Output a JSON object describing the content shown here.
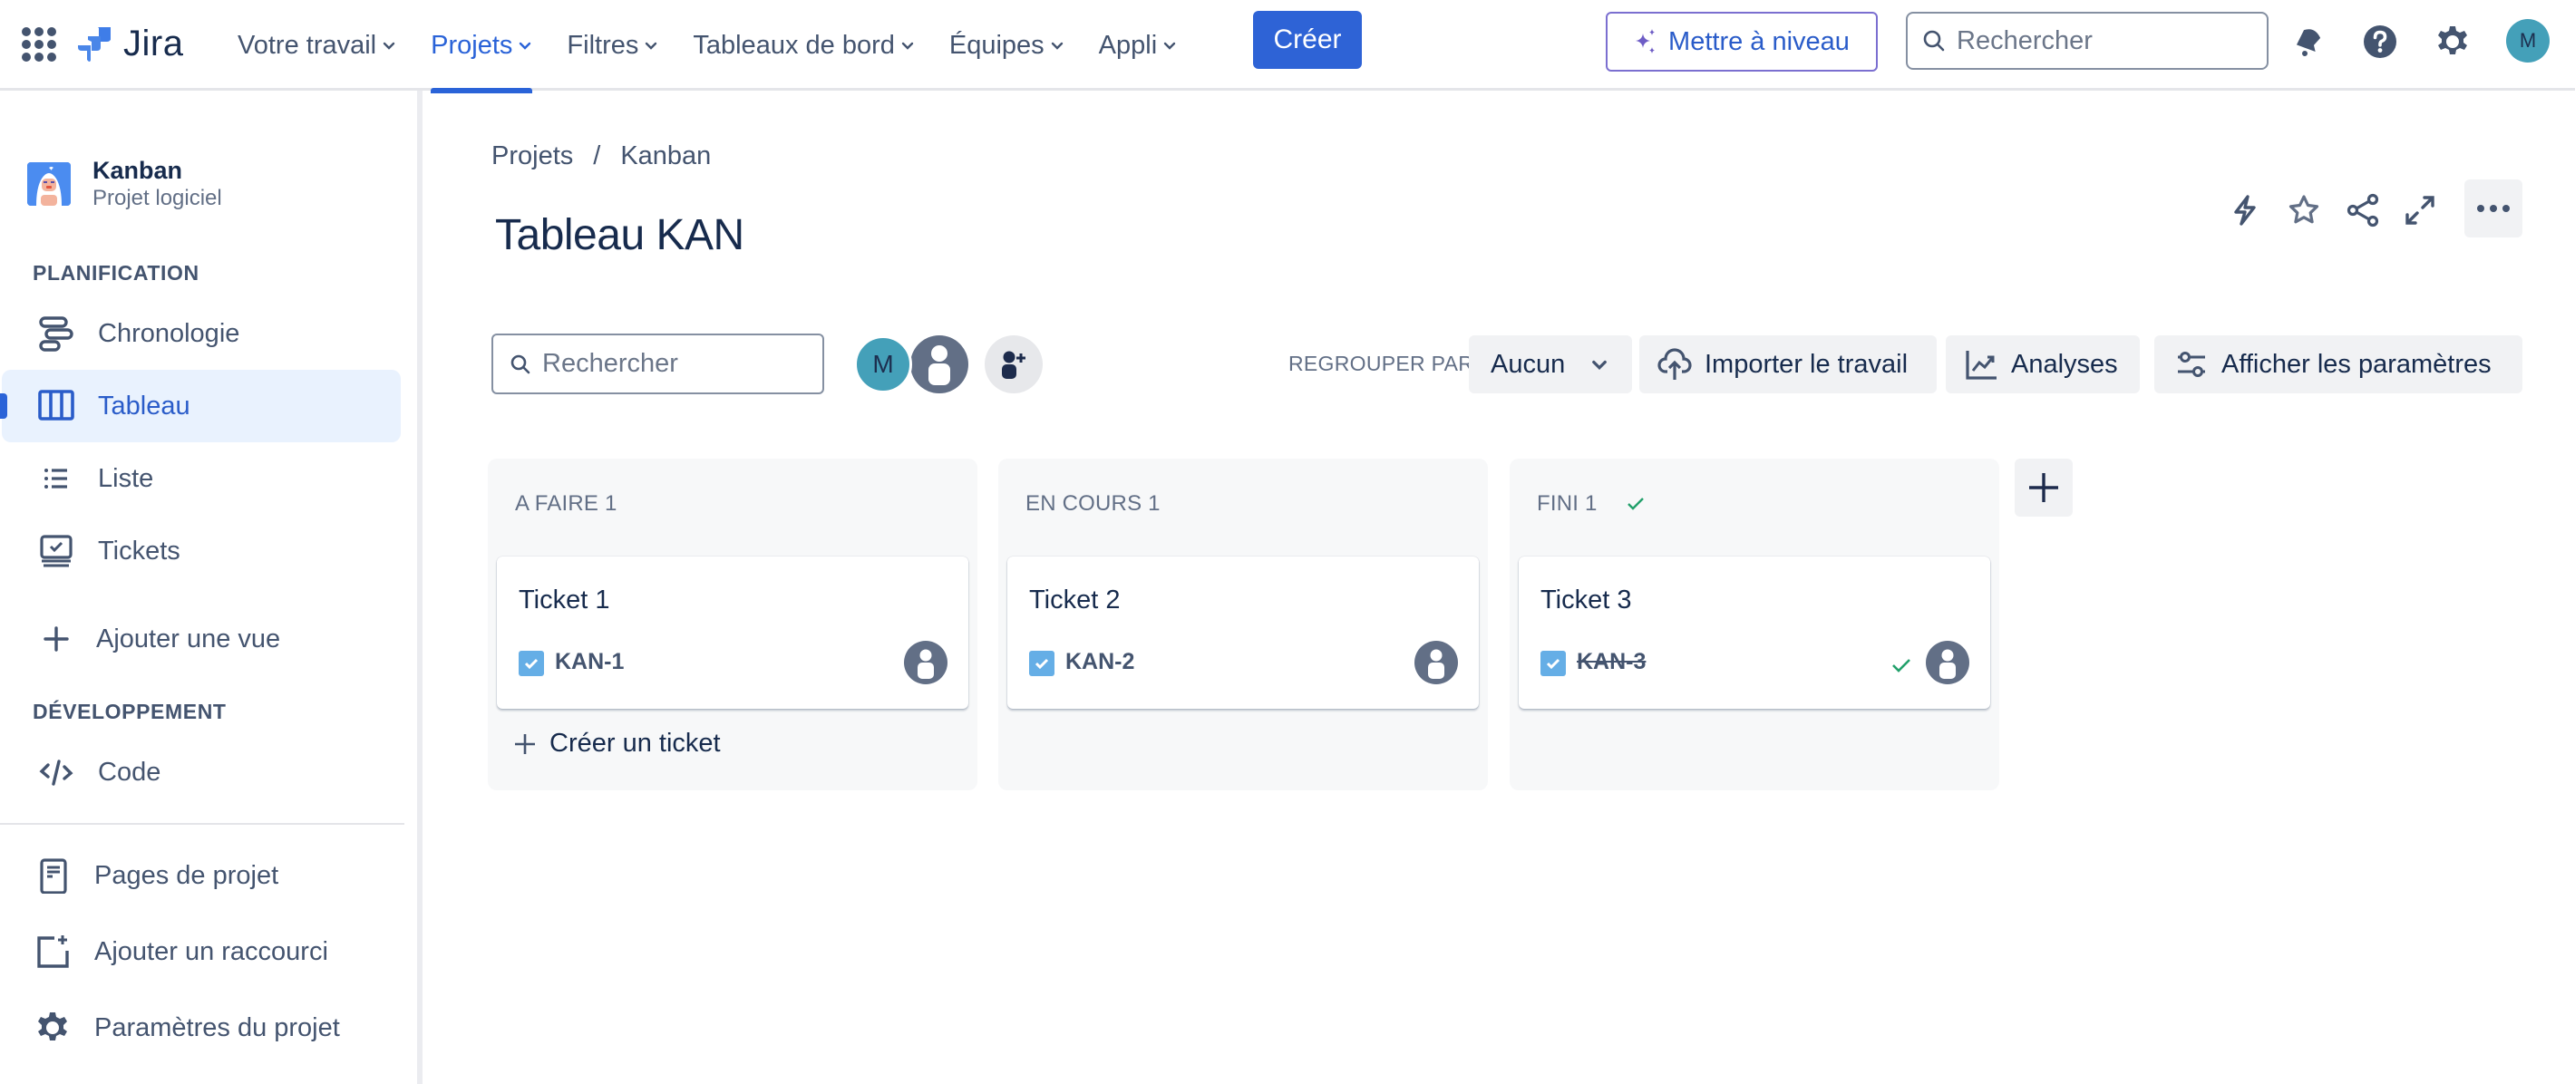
{
  "topbar": {
    "app_name": "Jira",
    "nav": [
      {
        "label": "Votre travail",
        "active": false
      },
      {
        "label": "Projets",
        "active": true
      },
      {
        "label": "Filtres",
        "active": false
      },
      {
        "label": "Tableaux de bord",
        "active": false
      },
      {
        "label": "Équipes",
        "active": false
      },
      {
        "label": "Appli",
        "active": false
      }
    ],
    "create_label": "Créer",
    "upgrade_label": "Mettre à niveau",
    "search_placeholder": "Rechercher",
    "icons": [
      "notifications-icon",
      "help-icon",
      "settings-icon"
    ],
    "user_initial": "M"
  },
  "sidebar": {
    "project": {
      "name": "Kanban",
      "type": "Projet logiciel"
    },
    "sections": [
      {
        "title": "PLANIFICATION"
      },
      {
        "title": "DÉVELOPPEMENT"
      }
    ],
    "items": [
      {
        "label": "Chronologie",
        "icon": "timeline-icon",
        "active": false
      },
      {
        "label": "Tableau",
        "icon": "board-icon",
        "active": true
      },
      {
        "label": "Liste",
        "icon": "list-icon",
        "active": false
      },
      {
        "label": "Tickets",
        "icon": "tickets-icon",
        "active": false
      },
      {
        "label": "Ajouter une vue",
        "icon": "plus-icon",
        "active": false
      },
      {
        "label": "Code",
        "icon": "code-icon",
        "active": false
      },
      {
        "label": "Pages de projet",
        "icon": "page-icon",
        "active": false
      },
      {
        "label": "Ajouter un raccourci",
        "icon": "add-shortcut-icon",
        "active": false
      },
      {
        "label": "Paramètres du projet",
        "icon": "settings-icon",
        "active": false
      }
    ]
  },
  "main": {
    "breadcrumb": [
      "Projets",
      "Kanban"
    ],
    "breadcrumb_separator": "/",
    "title": "Tableau KAN",
    "header_actions": [
      "automation-icon",
      "star-icon",
      "share-icon",
      "fullscreen-icon",
      "more-icon"
    ],
    "toolbar": {
      "search_placeholder": "Rechercher",
      "avatar_initial": "M",
      "group_by_label": "REGROUPER PAR",
      "group_by_value": "Aucun",
      "import_label": "Importer le travail",
      "analytics_label": "Analyses",
      "view_settings_label": "Afficher les paramètres"
    },
    "columns": [
      {
        "title": "A FAIRE 1",
        "done": false,
        "cards": [
          {
            "title": "Ticket 1",
            "key": "KAN-1",
            "done": false
          }
        ],
        "create_label": "Créer un ticket"
      },
      {
        "title": "EN COURS 1",
        "done": false,
        "cards": [
          {
            "title": "Ticket 2",
            "key": "KAN-2",
            "done": false
          }
        ]
      },
      {
        "title": "FINI 1",
        "done": true,
        "cards": [
          {
            "title": "Ticket 3",
            "key": "KAN-3",
            "done": true
          }
        ]
      }
    ]
  },
  "colors": {
    "brand_blue": "#2a63d8",
    "text_primary": "#172b4d",
    "text_subtle": "#44546f",
    "success_green": "#22a06b",
    "avatar_teal": "#44a0b9"
  }
}
